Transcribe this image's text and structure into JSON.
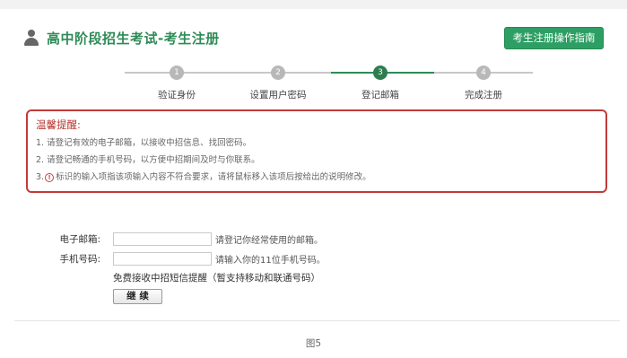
{
  "header": {
    "title": "高中阶段招生考试-考生注册",
    "guide_button": "考生注册操作指南"
  },
  "steps": [
    {
      "number": "1",
      "label": "验证身份",
      "active": false
    },
    {
      "number": "2",
      "label": "设置用户密码",
      "active": false
    },
    {
      "number": "3",
      "label": "登记邮箱",
      "active": true
    },
    {
      "number": "4",
      "label": "完成注册",
      "active": false
    }
  ],
  "tips": {
    "title": "温馨提醒:",
    "items": [
      "1. 请登记有效的电子邮箱，以接收中招信息、找回密码。",
      "2. 请登记畅通的手机号码，以方便中招期间及时与你联系。",
      "标识的输入项指该项输入内容不符合要求，请将鼠标移入该项后按给出的说明修改。"
    ],
    "item3_prefix": "3."
  },
  "form": {
    "email_label": "电子邮箱:",
    "email_value": "",
    "email_hint": "请登记你经常使用的邮箱。",
    "phone_label": "手机号码:",
    "phone_value": "",
    "phone_hint": "请输入你的11位手机号码。",
    "sms_note": "免费接收中招短信提醒（暂支持移动和联通号码）",
    "continue_button": "继 续"
  },
  "caption": "图5",
  "colors": {
    "brand_green": "#2e8b57",
    "button_green": "#2e9f64",
    "alert_red": "#c23a3a"
  }
}
